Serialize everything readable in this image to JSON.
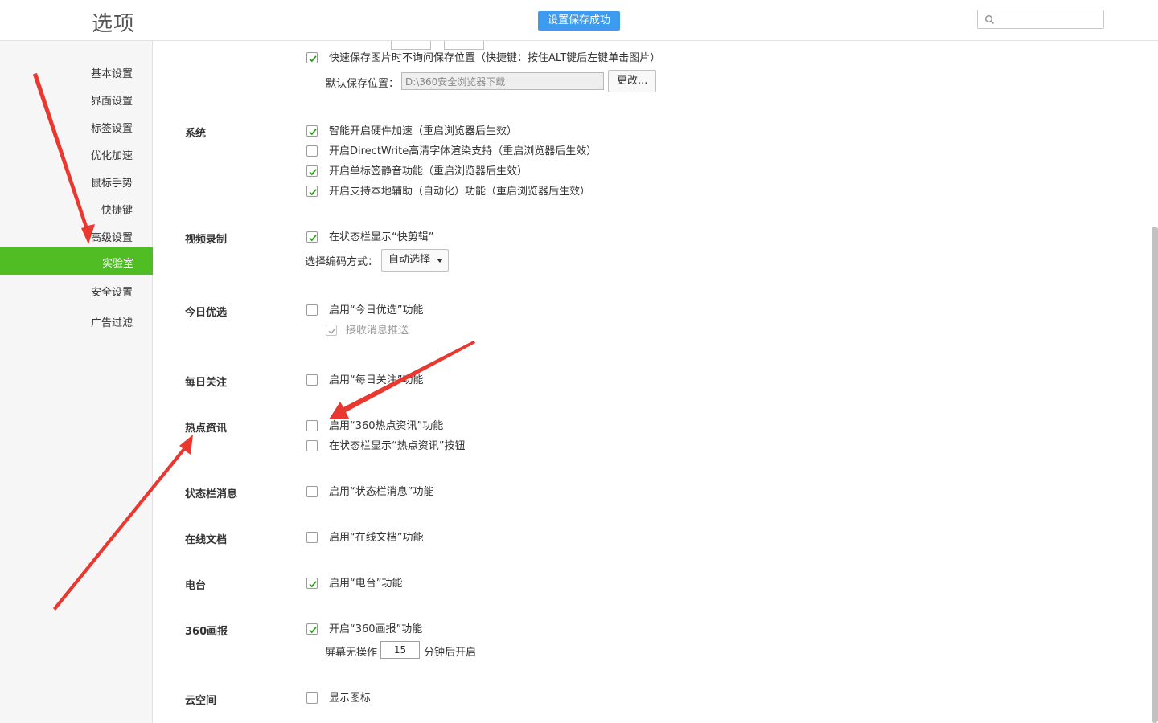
{
  "header": {
    "title": "选项",
    "toast": "设置保存成功",
    "search": {
      "placeholder": "",
      "value": ""
    }
  },
  "sidebar": {
    "items": [
      {
        "label": "基本设置"
      },
      {
        "label": "界面设置"
      },
      {
        "label": "标签设置"
      },
      {
        "label": "优化加速"
      },
      {
        "label": "鼠标手势"
      },
      {
        "label": "快捷键"
      },
      {
        "label": "高级设置"
      },
      {
        "label": "实验室",
        "active": true
      },
      {
        "label": "安全设置"
      },
      {
        "label": "广告过滤"
      }
    ]
  },
  "main": {
    "top": {
      "quick_save": {
        "label": "快速保存图片时不询问保存位置（快捷键：按住ALT键后左键单击图片）",
        "checked": true
      },
      "save_path_label": "默认保存位置：",
      "save_path_value": "D:\\360安全浏览器下载",
      "change_button": "更改..."
    },
    "sections": {
      "system": {
        "title": "系统",
        "options": [
          {
            "label": "智能开启硬件加速（重启浏览器后生效）",
            "checked": true
          },
          {
            "label": "开启DirectWrite高清字体渲染支持（重启浏览器后生效）",
            "checked": false
          },
          {
            "label": "开启单标签静音功能（重启浏览器后生效）",
            "checked": true
          },
          {
            "label": "开启支持本地辅助（自动化）功能（重启浏览器后生效）",
            "checked": true
          }
        ]
      },
      "video": {
        "title": "视频录制",
        "options": [
          {
            "label": "在状态栏显示“快剪辑”",
            "checked": true
          }
        ],
        "encode_label": "选择编码方式：",
        "encode_value": "自动选择"
      },
      "today": {
        "title": "今日优选",
        "options": [
          {
            "label": "启用“今日优选”功能",
            "checked": false
          },
          {
            "label": "接收消息推送",
            "checked": true,
            "disabled": true
          }
        ]
      },
      "daily": {
        "title": "每日关注",
        "options": [
          {
            "label": "启用“每日关注”功能",
            "checked": false
          }
        ]
      },
      "hot": {
        "title": "热点资讯",
        "options": [
          {
            "label": "启用“360热点资讯”功能",
            "checked": false
          },
          {
            "label": "在状态栏显示“热点资讯”按钮",
            "checked": false
          }
        ]
      },
      "statusbar": {
        "title": "状态栏消息",
        "options": [
          {
            "label": "启用“状态栏消息”功能",
            "checked": false
          }
        ]
      },
      "docs": {
        "title": "在线文档",
        "options": [
          {
            "label": "启用“在线文档”功能",
            "checked": false
          }
        ]
      },
      "radio": {
        "title": "电台",
        "options": [
          {
            "label": "启用“电台”功能",
            "checked": true
          }
        ]
      },
      "pictorial": {
        "title": "360画报",
        "options": [
          {
            "label": "开启“360画报”功能",
            "checked": true
          }
        ],
        "idle_prefix": "屏幕无操作",
        "idle_value": "15",
        "idle_suffix": "分钟后开启"
      },
      "cloud": {
        "title": "云空间",
        "options": [
          {
            "label": "显示图标",
            "checked": false
          }
        ]
      }
    }
  },
  "colors": {
    "accent_green": "#4fbd23",
    "toast_blue": "#3d9cf0",
    "check_green": "#2f9e1e",
    "annotation_red": "#e8382f"
  }
}
